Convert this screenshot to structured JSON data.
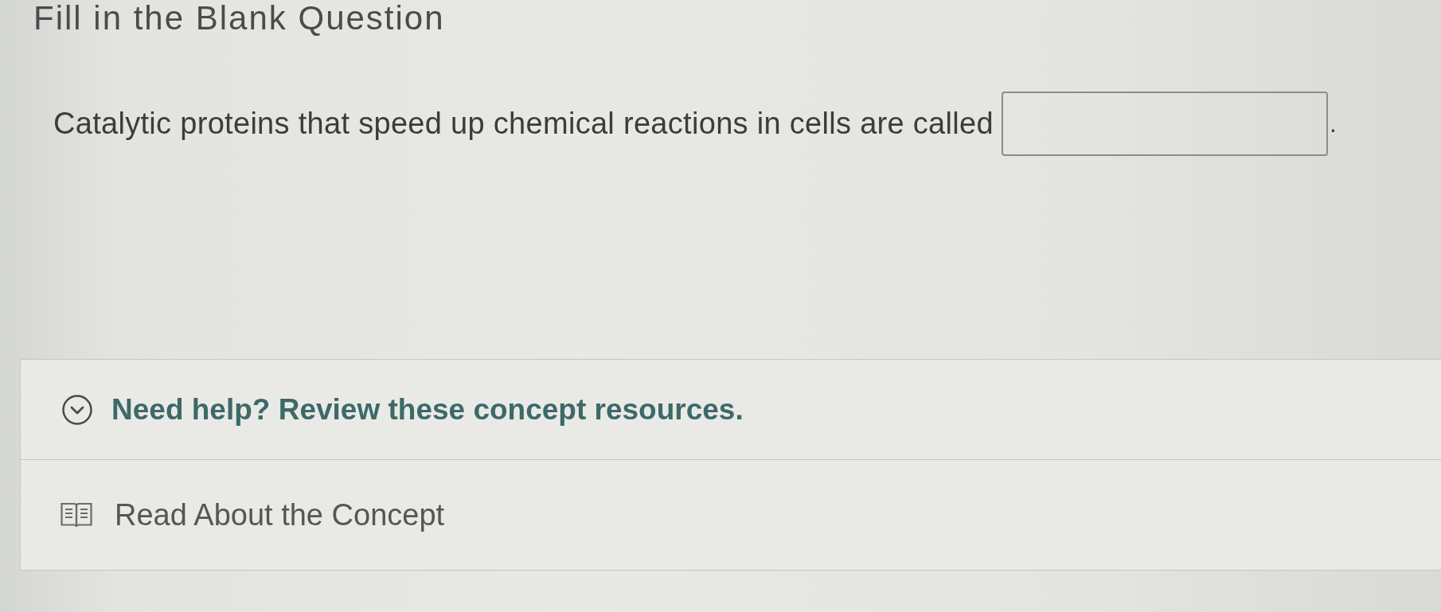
{
  "title": "Fill in the Blank Question",
  "question": {
    "prompt": "Catalytic proteins that speed up chemical reactions in cells are called",
    "ending": "."
  },
  "help": {
    "header": "Need help? Review these concept resources.",
    "expanded": true,
    "resources": [
      {
        "kind": "reading",
        "label": "Read About the Concept"
      }
    ]
  }
}
